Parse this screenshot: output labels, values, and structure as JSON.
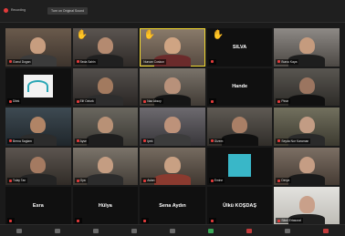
{
  "meeting": {
    "recording_label": "Recording",
    "topic_label": "Turn on Original Sound"
  },
  "tiles": [
    {
      "name": "Gonul Dogan",
      "type": "video",
      "c1": "#6a5a4c",
      "c2": "#3d342d",
      "skin": "#c79d7f",
      "shirt": "#3b3b3b",
      "muted": true
    },
    {
      "name": "Seda Sahin",
      "type": "video",
      "c1": "#5b5550",
      "c2": "#2f2b28",
      "skin": "#b48a70",
      "shirt": "#202020",
      "muted": true,
      "hand": true
    },
    {
      "name": "Nurcan Coskun",
      "type": "video",
      "c1": "#8a7b6b",
      "c2": "#564a40",
      "skin": "#cfa483",
      "shirt": "#6b2b2b",
      "muted": false,
      "hand": true,
      "speaking": true
    },
    {
      "name": "SILVA",
      "type": "name",
      "muted": true,
      "hand": true
    },
    {
      "name": "Burcu Kaya",
      "type": "video",
      "c1": "#8e8a86",
      "c2": "#4c4844",
      "skin": "#c59b7e",
      "shirt": "#1e1e1e",
      "muted": true
    },
    {
      "name": "Dilek",
      "type": "logo",
      "muted": true
    },
    {
      "name": "Elif Ozturk",
      "type": "video",
      "c1": "#54504c",
      "c2": "#2a2725",
      "skin": "#a27a5f",
      "shirt": "#2d2d2d",
      "muted": true
    },
    {
      "name": "Naz Aksoy",
      "type": "video",
      "c1": "#7a736a",
      "c2": "#413b35",
      "skin": "#b8917a",
      "shirt": "#151515",
      "muted": true
    },
    {
      "name": "Hande",
      "type": "name",
      "muted": true
    },
    {
      "name": "Pinar",
      "type": "video",
      "c1": "#595651",
      "c2": "#2d2b28",
      "skin": "#9b7560",
      "shirt": "#101010",
      "muted": true
    },
    {
      "name": "Berna Saglam",
      "type": "video",
      "c1": "#3e4a52",
      "c2": "#1f262b",
      "skin": "#b08466",
      "shirt": "#2c2c2c",
      "muted": true
    },
    {
      "name": "Ayse",
      "type": "video",
      "c1": "#6a675f",
      "c2": "#3a3833",
      "skin": "#b89176",
      "shirt": "#1e1e1e",
      "muted": true
    },
    {
      "name": "Ipek",
      "type": "video",
      "c1": "#6d6a6f",
      "c2": "#38363a",
      "skin": "#bd927a",
      "shirt": "#3c3c3c",
      "muted": true
    },
    {
      "name": "Gizem",
      "type": "video",
      "c1": "#5f5a54",
      "c2": "#302d29",
      "skin": "#a97f66",
      "shirt": "#101010",
      "muted": true
    },
    {
      "name": "Seyda Nur Karaman",
      "type": "video",
      "c1": "#72705e",
      "c2": "#3c3a30",
      "skin": "#c29c84",
      "shirt": "#2a2a2a",
      "muted": true
    },
    {
      "name": "Tulay Tan",
      "type": "video",
      "c1": "#5c5550",
      "c2": "#302b27",
      "skin": "#a47a61",
      "shirt": "#242424",
      "muted": true
    },
    {
      "name": "Oya",
      "type": "video",
      "c1": "#7b746a",
      "c2": "#433d37",
      "skin": "#c49d82",
      "shirt": "#2c2c2c",
      "muted": true
    },
    {
      "name": "Aslan",
      "type": "video",
      "c1": "#766b60",
      "c2": "#3f3730",
      "skin": "#c8a083",
      "shirt": "#8a3a2f",
      "muted": true
    },
    {
      "name": "Emine",
      "type": "teal",
      "muted": true
    },
    {
      "name": "Derya",
      "type": "video",
      "c1": "#7c6f64",
      "c2": "#453b33",
      "skin": "#c59d84",
      "shirt": "#1a1a1a",
      "muted": true
    },
    {
      "name": "Esra",
      "type": "name",
      "muted": true
    },
    {
      "name": "Hülya",
      "type": "name",
      "muted": true
    },
    {
      "name": "Sena Aydın",
      "type": "name",
      "muted": true
    },
    {
      "name": "Ülkü KOŞDAŞ",
      "type": "name",
      "muted": true
    },
    {
      "name": "Sibel Ertasoral",
      "type": "video",
      "c1": "#e3e2de",
      "c2": "#bdbbb5",
      "skin": "#c9a08a",
      "shirt": "#1f1f1f",
      "muted": true
    }
  ]
}
